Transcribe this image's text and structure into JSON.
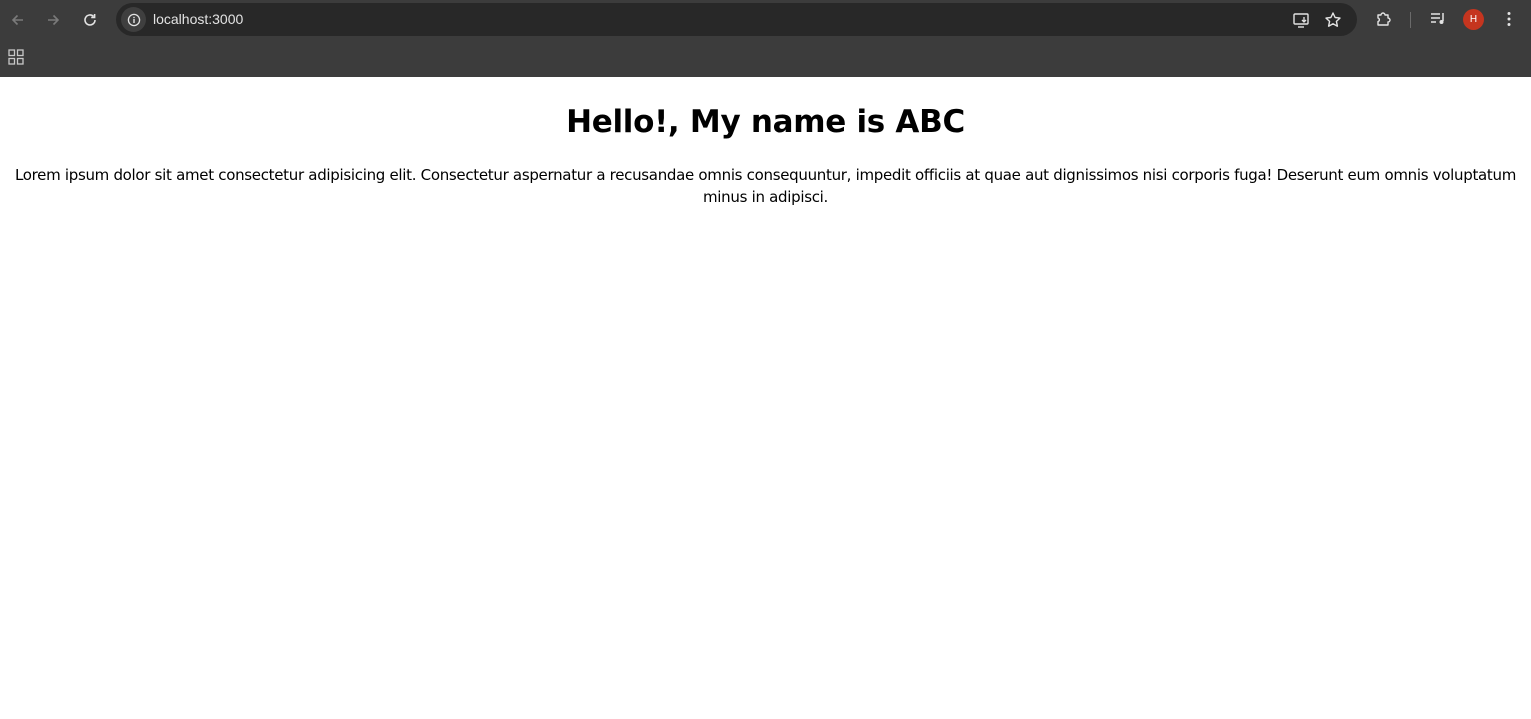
{
  "browser": {
    "url": "localhost:3000",
    "profile_initial": "H",
    "icons": {
      "back": "back-arrow-icon",
      "forward": "forward-arrow-icon",
      "reload": "reload-icon",
      "site_info": "info-icon",
      "install": "install-app-icon",
      "bookmark": "star-icon",
      "extensions": "puzzle-icon",
      "media": "media-controls-icon",
      "menu": "kebab-menu-icon",
      "apps": "apps-grid-icon"
    },
    "colors": {
      "toolbar": "#3c3c3c",
      "omnibox": "#282828",
      "avatar": "#c5351f"
    }
  },
  "page": {
    "heading": "Hello!, My name is ABC",
    "paragraph": "Lorem ipsum dolor sit amet consectetur adipisicing elit. Consectetur aspernatur a recusandae omnis consequuntur, impedit officiis at quae aut dignissimos nisi corporis fuga! Deserunt eum omnis voluptatum minus in adipisci."
  }
}
